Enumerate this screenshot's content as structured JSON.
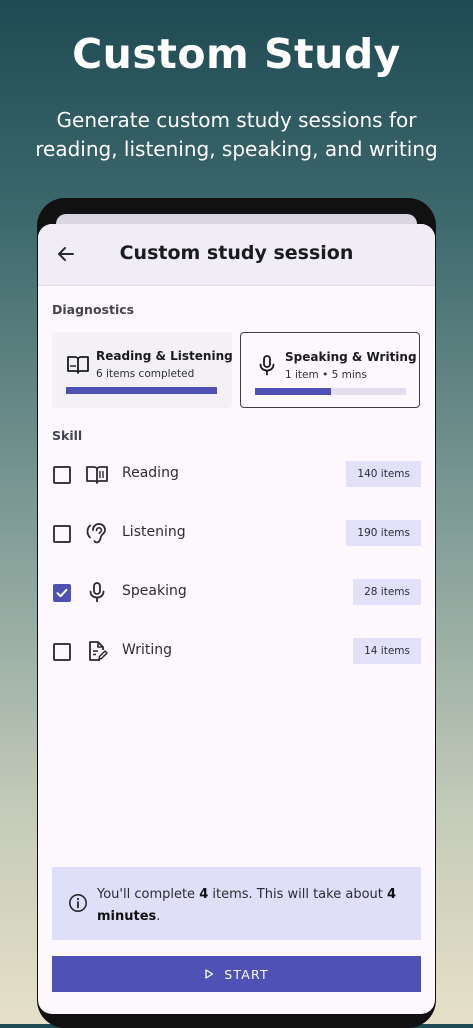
{
  "promo": {
    "title": "Custom Study",
    "subtitle_line1": "Generate custom study sessions for",
    "subtitle_line2": "reading, listening, speaking, and writing"
  },
  "appbar": {
    "back_icon": "arrow-left-icon",
    "title": "Custom study session"
  },
  "diagnostics": {
    "label": "Diagnostics",
    "cards": [
      {
        "title": "Reading & Listening",
        "subtitle": "6 items completed",
        "icon": "open-book-icon",
        "progress": 1.0,
        "selected": false
      },
      {
        "title": "Speaking & Writing",
        "subtitle": "1 item • 5 mins",
        "icon": "microphone-icon",
        "progress": 0.5,
        "selected": true
      }
    ]
  },
  "skills": {
    "label": "Skill",
    "items": [
      {
        "label": "Reading",
        "count": "140 items",
        "checked": false,
        "icon": "open-book-icon"
      },
      {
        "label": "Listening",
        "count": "190 items",
        "checked": false,
        "icon": "ear-icon"
      },
      {
        "label": "Speaking",
        "count": "28 items",
        "checked": true,
        "icon": "microphone-icon"
      },
      {
        "label": "Writing",
        "count": "14 items",
        "checked": false,
        "icon": "edit-document-icon"
      }
    ]
  },
  "summary": {
    "icon": "info-icon",
    "text_before": "You'll complete ",
    "item_count": "4",
    "text_middle": " items. This will take about ",
    "minutes": "4",
    "minutes_word": "minutes",
    "text_end": "."
  },
  "start_button": {
    "label": "START",
    "icon": "play-icon"
  },
  "colors": {
    "accent": "#4f51b4",
    "badge_bg": "#e3e1fa",
    "info_bg": "#e0dffa"
  }
}
